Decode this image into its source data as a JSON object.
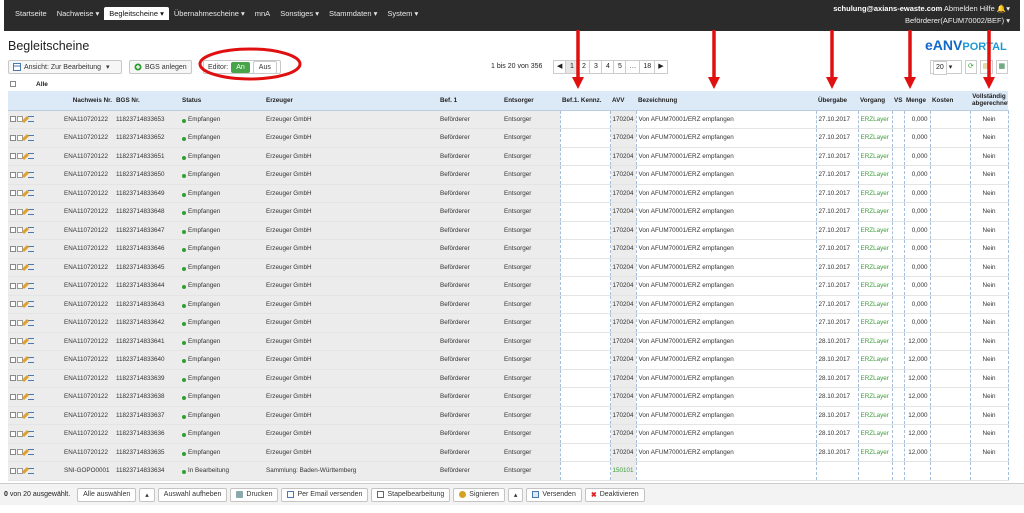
{
  "nav": {
    "items": [
      "Startseite",
      "Nachweise ▾",
      "Begleitscheine ▾",
      "Übernahmescheine ▾",
      "mnA",
      "Sonstiges ▾",
      "Stammdaten ▾",
      "System ▾"
    ],
    "active_index": 2
  },
  "user": {
    "email": "schulung@axians-ewaste.com",
    "logout": "Abmelden",
    "help": "Hilfe",
    "bell": "🔔▾",
    "role": "Beförderer(AFUM70002/BEF) ▾"
  },
  "page": {
    "title": "Begleitscheine",
    "logo_e": "eANV",
    "logo_portal": "PORTAL"
  },
  "toolbar": {
    "view_label": "Ansicht: Zur Bearbeitung",
    "bgs_label": "BGS anlegen",
    "editor_label": "Editor:",
    "editor_on": "An",
    "editor_off": "Aus"
  },
  "pager": {
    "info": "1 bis 20 von 356",
    "pages": [
      "◀",
      "1",
      "2",
      "3",
      "4",
      "5",
      "…",
      "18",
      "▶"
    ],
    "page_size": "20"
  },
  "filter": {
    "all_label": "Alle"
  },
  "table": {
    "headers": [
      "",
      "Nachweis Nr.",
      "BGS Nr.",
      "Status",
      "Erzeuger",
      "Bef. 1",
      "Entsorger",
      "Bef.1. Kennz.",
      "AVV",
      "Bezeichnung",
      "Übergabe",
      "Vorgang",
      "VS",
      "Menge",
      "Kosten",
      "Vollständig abgerechnet"
    ],
    "rows": [
      [
        "ENA110720122",
        "11823714833653",
        "Empfangen",
        "Erzeuger GmbH",
        "Beförderer",
        "Entsorger",
        "",
        "170204",
        "Von AFUM70001/ERZ empfangen",
        "27.10.2017",
        "ERZLayer",
        "",
        "0,000",
        "",
        "Nein"
      ],
      [
        "ENA110720122",
        "11823714833652",
        "Empfangen",
        "Erzeuger GmbH",
        "Beförderer",
        "Entsorger",
        "",
        "170204",
        "Von AFUM70001/ERZ empfangen",
        "27.10.2017",
        "ERZLayer",
        "",
        "0,000",
        "",
        "Nein"
      ],
      [
        "ENA110720122",
        "11823714833651",
        "Empfangen",
        "Erzeuger GmbH",
        "Beförderer",
        "Entsorger",
        "",
        "170204",
        "Von AFUM70001/ERZ empfangen",
        "27.10.2017",
        "ERZLayer",
        "",
        "0,000",
        "",
        "Nein"
      ],
      [
        "ENA110720122",
        "11823714833650",
        "Empfangen",
        "Erzeuger GmbH",
        "Beförderer",
        "Entsorger",
        "",
        "170204",
        "Von AFUM70001/ERZ empfangen",
        "27.10.2017",
        "ERZLayer",
        "",
        "0,000",
        "",
        "Nein"
      ],
      [
        "ENA110720122",
        "11823714833649",
        "Empfangen",
        "Erzeuger GmbH",
        "Beförderer",
        "Entsorger",
        "",
        "170204",
        "Von AFUM70001/ERZ empfangen",
        "27.10.2017",
        "ERZLayer",
        "",
        "0,000",
        "",
        "Nein"
      ],
      [
        "ENA110720122",
        "11823714833648",
        "Empfangen",
        "Erzeuger GmbH",
        "Beförderer",
        "Entsorger",
        "",
        "170204",
        "Von AFUM70001/ERZ empfangen",
        "27.10.2017",
        "ERZLayer",
        "",
        "0,000",
        "",
        "Nein"
      ],
      [
        "ENA110720122",
        "11823714833647",
        "Empfangen",
        "Erzeuger GmbH",
        "Beförderer",
        "Entsorger",
        "",
        "170204",
        "Von AFUM70001/ERZ empfangen",
        "27.10.2017",
        "ERZLayer",
        "",
        "0,000",
        "",
        "Nein"
      ],
      [
        "ENA110720122",
        "11823714833646",
        "Empfangen",
        "Erzeuger GmbH",
        "Beförderer",
        "Entsorger",
        "",
        "170204",
        "Von AFUM70001/ERZ empfangen",
        "27.10.2017",
        "ERZLayer",
        "",
        "0,000",
        "",
        "Nein"
      ],
      [
        "ENA110720122",
        "11823714833645",
        "Empfangen",
        "Erzeuger GmbH",
        "Beförderer",
        "Entsorger",
        "",
        "170204",
        "Von AFUM70001/ERZ empfangen",
        "27.10.2017",
        "ERZLayer",
        "",
        "0,000",
        "",
        "Nein"
      ],
      [
        "ENA110720122",
        "11823714833644",
        "Empfangen",
        "Erzeuger GmbH",
        "Beförderer",
        "Entsorger",
        "",
        "170204",
        "Von AFUM70001/ERZ empfangen",
        "27.10.2017",
        "ERZLayer",
        "",
        "0,000",
        "",
        "Nein"
      ],
      [
        "ENA110720122",
        "11823714833643",
        "Empfangen",
        "Erzeuger GmbH",
        "Beförderer",
        "Entsorger",
        "",
        "170204",
        "Von AFUM70001/ERZ empfangen",
        "27.10.2017",
        "ERZLayer",
        "",
        "0,000",
        "",
        "Nein"
      ],
      [
        "ENA110720122",
        "11823714833642",
        "Empfangen",
        "Erzeuger GmbH",
        "Beförderer",
        "Entsorger",
        "",
        "170204",
        "Von AFUM70001/ERZ empfangen",
        "27.10.2017",
        "ERZLayer",
        "",
        "0,000",
        "",
        "Nein"
      ],
      [
        "ENA110720122",
        "11823714833641",
        "Empfangen",
        "Erzeuger GmbH",
        "Beförderer",
        "Entsorger",
        "",
        "170204",
        "Von AFUM70001/ERZ empfangen",
        "28.10.2017",
        "ERZLayer",
        "",
        "12,000",
        "",
        "Nein"
      ],
      [
        "ENA110720122",
        "11823714833640",
        "Empfangen",
        "Erzeuger GmbH",
        "Beförderer",
        "Entsorger",
        "",
        "170204",
        "Von AFUM70001/ERZ empfangen",
        "28.10.2017",
        "ERZLayer",
        "",
        "12,000",
        "",
        "Nein"
      ],
      [
        "ENA110720122",
        "11823714833639",
        "Empfangen",
        "Erzeuger GmbH",
        "Beförderer",
        "Entsorger",
        "",
        "170204",
        "Von AFUM70001/ERZ empfangen",
        "28.10.2017",
        "ERZLayer",
        "",
        "12,000",
        "",
        "Nein"
      ],
      [
        "ENA110720122",
        "11823714833638",
        "Empfangen",
        "Erzeuger GmbH",
        "Beförderer",
        "Entsorger",
        "",
        "170204",
        "Von AFUM70001/ERZ empfangen",
        "28.10.2017",
        "ERZLayer",
        "",
        "12,000",
        "",
        "Nein"
      ],
      [
        "ENA110720122",
        "11823714833637",
        "Empfangen",
        "Erzeuger GmbH",
        "Beförderer",
        "Entsorger",
        "",
        "170204",
        "Von AFUM70001/ERZ empfangen",
        "28.10.2017",
        "ERZLayer",
        "",
        "12,000",
        "",
        "Nein"
      ],
      [
        "ENA110720122",
        "11823714833636",
        "Empfangen",
        "Erzeuger GmbH",
        "Beförderer",
        "Entsorger",
        "",
        "170204",
        "Von AFUM70001/ERZ empfangen",
        "28.10.2017",
        "ERZLayer",
        "",
        "12,000",
        "",
        "Nein"
      ],
      [
        "ENA110720122",
        "11823714833635",
        "Empfangen",
        "Erzeuger GmbH",
        "Beförderer",
        "Entsorger",
        "",
        "170204",
        "Von AFUM70001/ERZ empfangen",
        "28.10.2017",
        "ERZLayer",
        "",
        "12,000",
        "",
        "Nein"
      ],
      [
        "SNI-GOPO0001",
        "11823714833634",
        "In Bearbeitung",
        "Sammlung: Baden-Württemberg",
        "Beförderer",
        "Entsorger",
        "",
        "150101",
        "",
        "",
        "",
        "",
        "",
        "",
        ""
      ]
    ]
  },
  "footer": {
    "selected_count": "0",
    "selected_text": " von 20 ausgewählt.",
    "buttons": [
      "Alle auswählen",
      "▴",
      "Auswahl aufheben",
      "Drucken",
      "Per Email versenden",
      "Stapelbearbeitung",
      "Signieren",
      "▴",
      "Versenden",
      "Deaktivieren"
    ]
  },
  "colors": {
    "nav_bg": "#2b2b2b",
    "header_bg": "#dce9f6",
    "accent": "#1268c7",
    "status_green": "#2fa02f",
    "annotation_red": "#e01010"
  }
}
